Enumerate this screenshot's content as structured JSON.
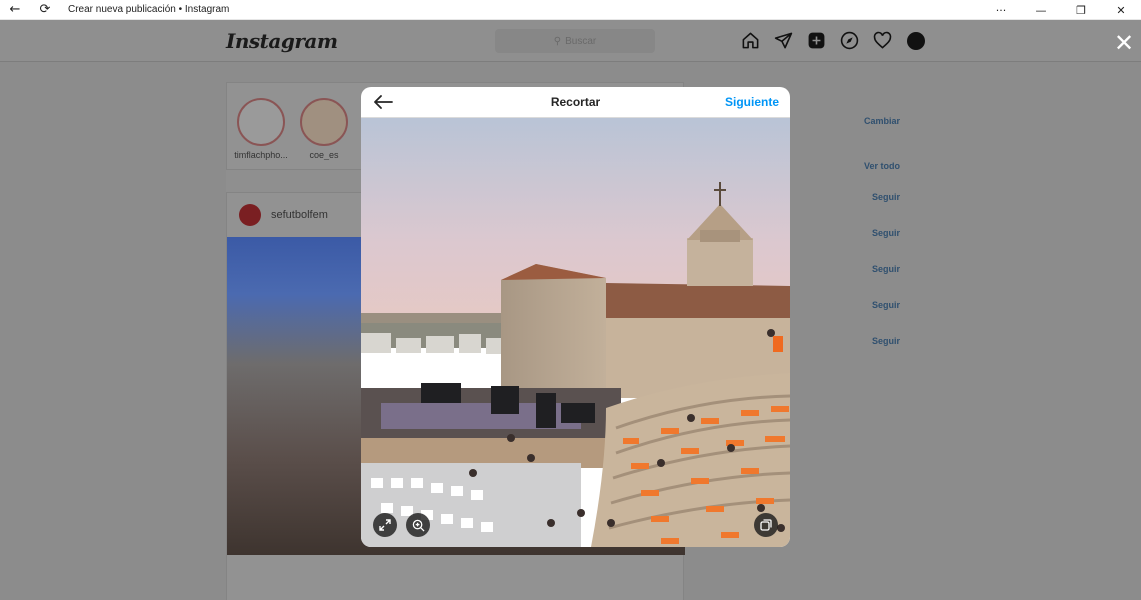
{
  "window": {
    "title": "Crear nueva publicación • Instagram",
    "back_glyph": "←",
    "refresh_glyph": "⟳",
    "more_glyph": "···",
    "minimize_glyph": "—",
    "maximize_glyph": "❐",
    "close_glyph": "✕"
  },
  "instagram": {
    "logo": "Instagram",
    "search_placeholder": "Buscar",
    "nav_icons": [
      "home-icon",
      "direct-icon",
      "new-post-icon",
      "explore-icon",
      "activity-icon",
      "profile-avatar"
    ],
    "stories": [
      {
        "label": "timflachpho..."
      },
      {
        "label": "coe_es"
      }
    ],
    "post": {
      "username": "sefutbolfem"
    },
    "suggestions": {
      "switch_label": "Cambiar",
      "see_all_label": "Ver todo",
      "follow_label": "Seguir"
    }
  },
  "overlay": {
    "close_glyph": "✕"
  },
  "modal": {
    "title": "Recortar",
    "next_label": "Siguiente",
    "tools": [
      "expand-icon",
      "zoom-icon",
      "multiple-images-icon"
    ]
  },
  "colors": {
    "accent_blue": "#0095f6",
    "overlay_dim": "#8c8c8c",
    "titlebar_bg": "#ffffff"
  }
}
